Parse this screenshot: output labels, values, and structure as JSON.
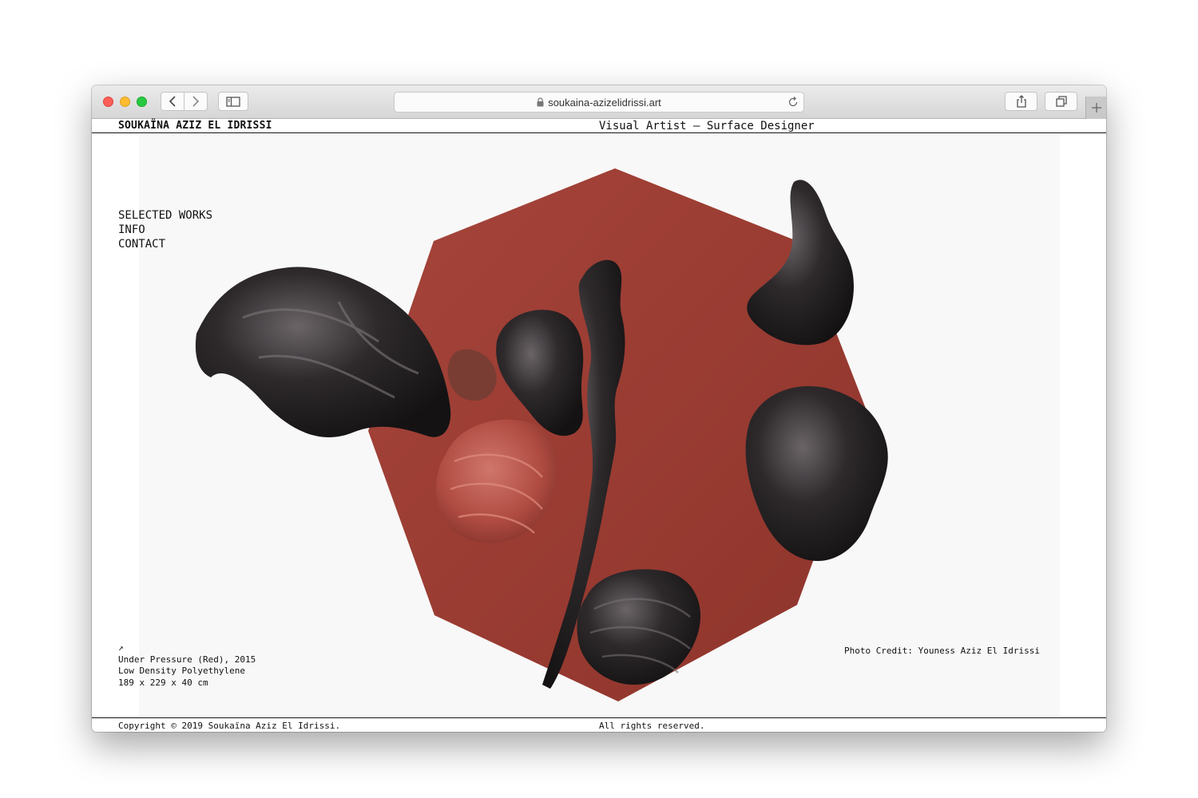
{
  "browser": {
    "url": "soukaina-azizelidrissi.art",
    "icons": [
      "back-icon",
      "forward-icon",
      "sidebar-icon",
      "lock-icon",
      "reload-icon",
      "share-icon",
      "tabs-icon",
      "new-tab-icon"
    ]
  },
  "site": {
    "name": "SOUKAÏNA AZIZ EL IDRISSI",
    "tagline": "Visual Artist — Surface Designer"
  },
  "nav": {
    "items": [
      {
        "label": "SELECTED WORKS"
      },
      {
        "label": "INFO"
      },
      {
        "label": "CONTACT"
      }
    ]
  },
  "artwork": {
    "arrow": "↗",
    "title": "Under Pressure (Red), 2015",
    "material": "Low Density Polyethylene",
    "dimensions": "189 x 229 x 40 cm",
    "credit": "Photo Credit: Youness Aziz El Idrissi"
  },
  "footer": {
    "copyright": "Copyright © 2019 Soukaïna Aziz El Idrissi.",
    "rights": "All rights reserved."
  },
  "colors": {
    "octagon": "#9c3b30",
    "sculpture_dark": "#2a2628",
    "sculpture_red": "#b5534a"
  }
}
